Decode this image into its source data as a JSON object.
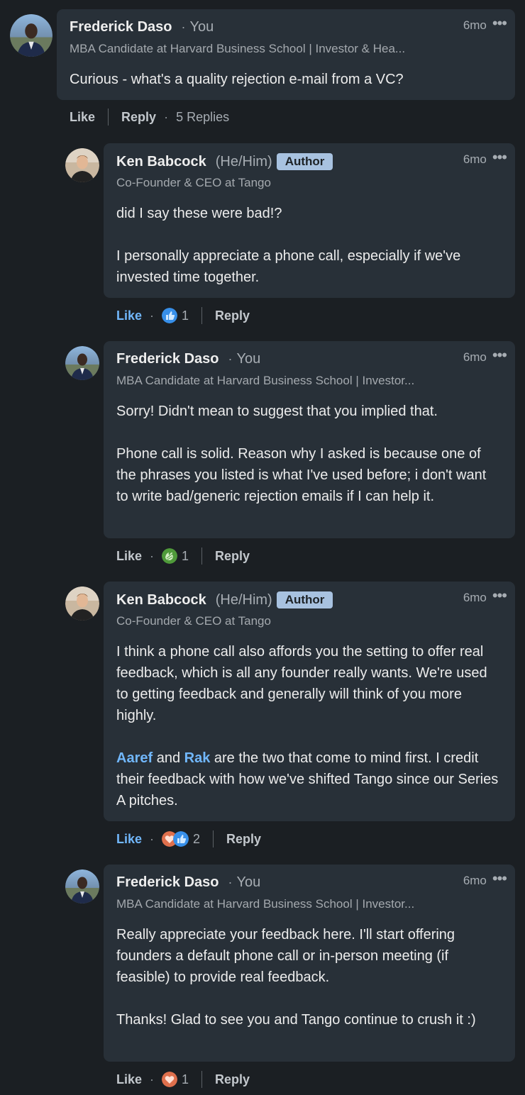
{
  "comments": [
    {
      "name": "Frederick Daso",
      "you_label": "You",
      "headline": "MBA Candidate at Harvard Business School | Investor & Hea...",
      "time": "6mo",
      "paragraphs": [
        "Curious - what's a quality rejection e-mail from a VC?"
      ],
      "like_label": "Like",
      "reply_label": "Reply",
      "replies_label": "5 Replies"
    },
    {
      "name": "Ken Babcock",
      "pronouns": "(He/Him)",
      "badge": "Author",
      "headline": "Co-Founder & CEO at Tango",
      "time": "6mo",
      "paragraphs": [
        "did I say these were bad!?",
        "I personally appreciate a phone call, especially if we've invested time together."
      ],
      "like_label": "Like",
      "reaction_count": "1",
      "reactions": [
        "like-reaction-icon"
      ],
      "reply_label": "Reply"
    },
    {
      "name": "Frederick Daso",
      "you_label": "You",
      "headline": "MBA Candidate at Harvard Business School | Investor...",
      "time": "6mo",
      "paragraphs": [
        "Sorry! Didn't mean to suggest that you implied that.",
        "Phone call is solid. Reason why I asked is because one of the phrases you listed is what I've used before; i don't want to write bad/generic rejection emails if I can help it."
      ],
      "like_label": "Like",
      "reaction_count": "1",
      "reactions": [
        "celebrate-reaction-icon"
      ],
      "reply_label": "Reply"
    },
    {
      "name": "Ken Babcock",
      "pronouns": "(He/Him)",
      "badge": "Author",
      "headline": "Co-Founder & CEO at Tango",
      "time": "6mo",
      "paragraphs": [
        "I think a phone call also affords you the setting to offer real feedback, which is all any founder really wants. We're used to getting feedback and generally will think of you more highly."
      ],
      "mention_1": "Aaref",
      "mention_join": " and ",
      "mention_2": "Rak",
      "mention_rest": " are the two that come to mind first. I credit their feedback with how we've shifted Tango since our Series A pitches.",
      "like_label": "Like",
      "reaction_count": "2",
      "reactions": [
        "love-reaction-icon",
        "like-reaction-icon"
      ],
      "reply_label": "Reply"
    },
    {
      "name": "Frederick Daso",
      "you_label": "You",
      "headline": "MBA Candidate at Harvard Business School | Investor...",
      "time": "6mo",
      "paragraphs": [
        "Really appreciate your feedback here. I'll start offering founders a default phone call or in-person meeting (if feasible) to provide real feedback.",
        "Thanks! Glad to see you and Tango continue to crush it :)"
      ],
      "like_label": "Like",
      "reaction_count": "1",
      "reactions": [
        "love-reaction-icon"
      ],
      "reply_label": "Reply"
    }
  ],
  "more_glyph": "•••",
  "separator_glyph": "·",
  "colors": {
    "background": "#1b1f23",
    "bubble": "#283038",
    "link_blue": "#71b7fb",
    "author_badge": "#a8c2e0"
  }
}
